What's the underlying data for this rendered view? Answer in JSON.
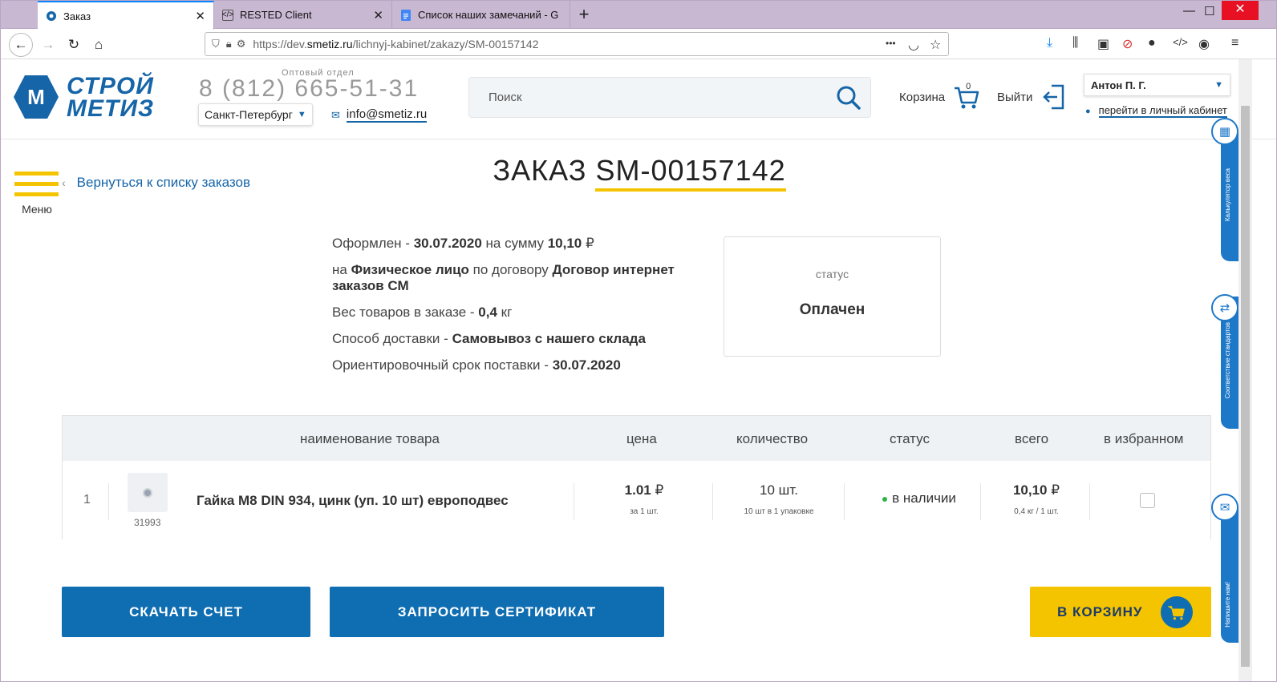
{
  "browser": {
    "tabs": [
      {
        "label": "Заказ",
        "active": true,
        "icon": "smetiz-favicon"
      },
      {
        "label": "RESTED Client",
        "active": false,
        "icon": "code-icon"
      },
      {
        "label": "Список наших замечаний - G",
        "active": false,
        "icon": "google-docs-icon"
      }
    ],
    "new_tab": "+",
    "close_tab": "✕",
    "url_prefix": "https://dev.",
    "url_domain": "smetiz.ru",
    "url_path": "/lichnyj-kabinet/zakazy/SM-00157142",
    "more": "•••"
  },
  "header": {
    "logo_line1": "СТРОЙ",
    "logo_line2": "МЕТИЗ",
    "logo_mark": "М",
    "wholesale_label": "Оптовый отдел",
    "phone": "8 (812) 665-51-31",
    "city": "Санкт-Петербург",
    "email": "info@smetiz.ru",
    "search_placeholder": "Поиск",
    "cart_label": "Корзина",
    "cart_count": "0",
    "logout_label": "Выйти",
    "user_name": "Антон П. Г.",
    "cabinet_link": "перейти в личный кабинет"
  },
  "nav": {
    "menu_label": "Меню",
    "back_link": "Вернуться к списку заказов"
  },
  "order": {
    "title_prefix": "ЗАКАЗ",
    "number": "SM-00157142",
    "placed_label": "Оформлен -",
    "placed_date": "30.07.2020",
    "sum_label": "на сумму",
    "sum_value": "10,10",
    "currency": "₽",
    "payer_prefix": "на",
    "payer": "Физическое лицо",
    "contract_label": "по договору",
    "contract": "Договор интернет заказов СМ",
    "weight_label": "Вес товаров в заказе -",
    "weight_value": "0,4",
    "weight_unit": "кг",
    "delivery_label": "Способ доставки -",
    "delivery_value": "Самовывоз с нашего склада",
    "eta_label": "Ориентировочный срок поставки -",
    "eta_value": "30.07.2020",
    "status_label": "статус",
    "status_value": "Оплачен"
  },
  "table": {
    "headers": {
      "name": "наименование товара",
      "price": "цена",
      "qty": "количество",
      "status": "статус",
      "total": "всего",
      "favorite": "в избранном"
    },
    "rows": [
      {
        "num": "1",
        "sku": "31993",
        "name": "Гайка М8 DIN 934, цинк (уп. 10 шт) европодвес",
        "price": "1.01",
        "price_note": "за 1 шт.",
        "qty": "10 шт.",
        "qty_note": "10 шт в 1 упаковке",
        "status": "в наличии",
        "total": "10,10",
        "total_note": "0,4 кг / 1 шт.",
        "favorite": false
      }
    ]
  },
  "actions": {
    "download_invoice": "СКАЧАТЬ СЧЕТ",
    "request_certificate": "ЗАПРОСИТЬ СЕРТИФИКАТ",
    "to_cart": "В КОРЗИНУ"
  },
  "side_widgets": {
    "weight_calc": "Калькулятор веса",
    "standards": "Соответствие стандартов",
    "write_us": "Напишите нам!"
  },
  "colors": {
    "brand_blue": "#1565a8",
    "button_blue": "#0f6db2",
    "accent_yellow": "#f5c400",
    "stock_green": "#2fb344"
  }
}
